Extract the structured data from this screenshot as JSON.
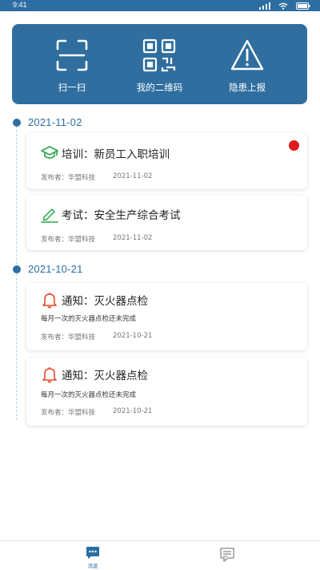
{
  "status_bar": {
    "time": "9:41"
  },
  "quick_actions": [
    {
      "label": "扫一扫",
      "icon": "scan-icon"
    },
    {
      "label": "我的二维码",
      "icon": "qr-code-icon"
    },
    {
      "label": "隐患上报",
      "icon": "warning-icon"
    }
  ],
  "groups": [
    {
      "date": "2021-11-02",
      "cards": [
        {
          "title": "培训：新员工入职培训",
          "icon": "graduation-cap-icon",
          "description": "",
          "publisher": "发布者：华盟科技",
          "date": "2021-11-02",
          "unread": true
        },
        {
          "title": "考试：安全生产综合考试",
          "icon": "pencil-icon",
          "description": "",
          "publisher": "发布者：华盟科技",
          "date": "2021-11-02",
          "unread": false
        }
      ]
    },
    {
      "date": "2021-10-21",
      "cards": [
        {
          "title": "通知：灭火器点检",
          "icon": "bell-icon",
          "description": "每月一次的灭火器点检还未完成",
          "publisher": "发布者：华盟科技",
          "date": "2021-10-21",
          "unread": false
        },
        {
          "title": "通知：灭火器点检",
          "icon": "bell-icon",
          "description": "每月一次的灭火器点检还未完成",
          "publisher": "发布者：华盟科技",
          "date": "2021-10-21",
          "unread": false
        }
      ]
    }
  ],
  "tabbar": {
    "tabs": [
      {
        "label": "消息",
        "icon": "message-icon",
        "active": true
      },
      {
        "label": "",
        "icon": "notes-icon",
        "active": false
      }
    ]
  },
  "colors": {
    "primary": "#2f6e9f",
    "badge": "#e01a1a",
    "training_icon": "#2aa54a",
    "exam_icon": "#2aa54a",
    "notice_icon": "#e04a2c"
  }
}
